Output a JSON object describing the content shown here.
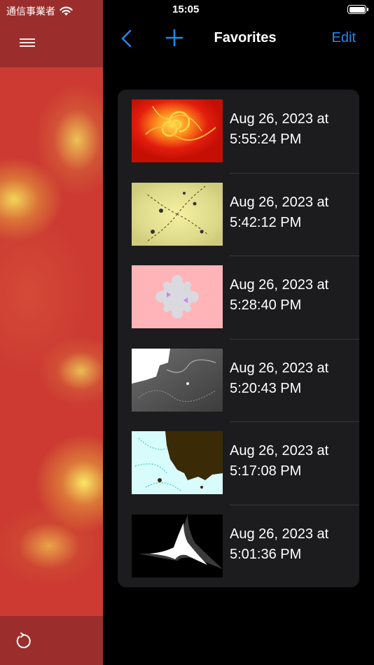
{
  "status_bar": {
    "carrier": "通信事業者",
    "time": "15:05"
  },
  "nav": {
    "title": "Favorites",
    "edit_label": "Edit"
  },
  "favorites": [
    {
      "line1": "Aug 26, 2023 at",
      "line2": "5:55:24 PM"
    },
    {
      "line1": "Aug 26, 2023 at",
      "line2": "5:42:12 PM"
    },
    {
      "line1": "Aug 26, 2023 at",
      "line2": "5:28:40 PM"
    },
    {
      "line1": "Aug 26, 2023 at",
      "line2": "5:20:43 PM"
    },
    {
      "line1": "Aug 26, 2023 at",
      "line2": "5:17:08 PM"
    },
    {
      "line1": "Aug 26, 2023 at",
      "line2": "5:01:36 PM"
    }
  ],
  "colors": {
    "accent": "#1e88f2",
    "list_background": "#1c1c1e",
    "sidebar_bar": "#9b2e2c"
  },
  "icons": [
    "wifi-icon",
    "battery-icon",
    "menu-icon",
    "refresh-icon",
    "back-chevron-icon",
    "plus-icon"
  ]
}
